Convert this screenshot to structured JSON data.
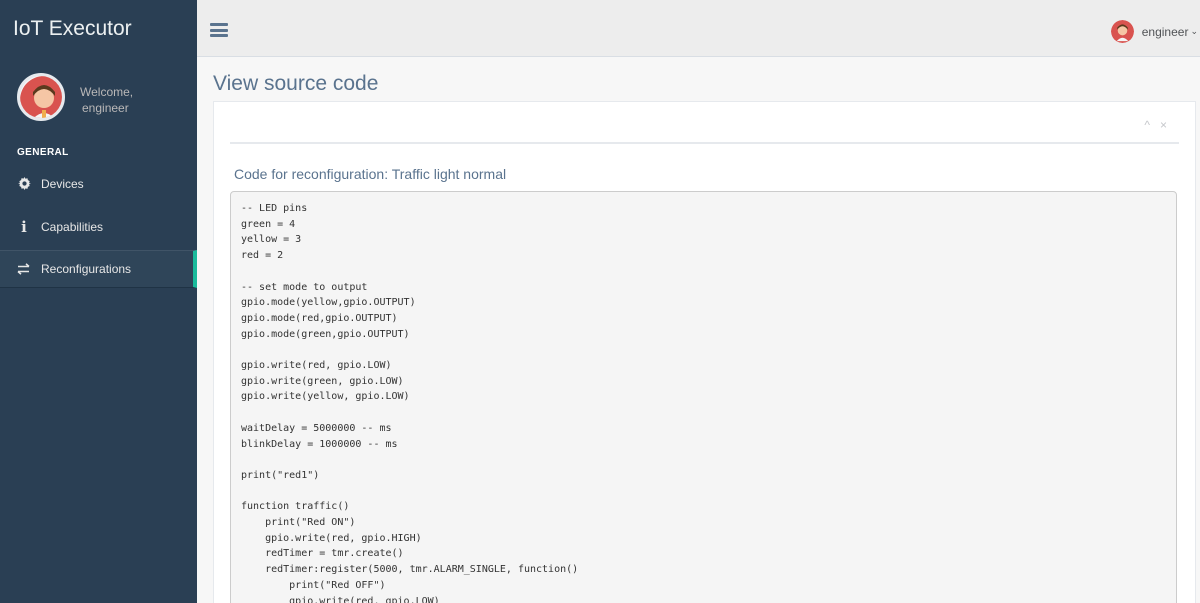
{
  "app": {
    "title": "IoT Executor"
  },
  "profile": {
    "welcome": "Welcome,",
    "name": "engineer"
  },
  "sidebar": {
    "section_title": "GENERAL",
    "items": [
      {
        "label": "Devices",
        "icon": "gear-icon"
      },
      {
        "label": "Capabilities",
        "icon": "info-icon"
      },
      {
        "label": "Reconfigurations",
        "icon": "exchange-arrows-icon",
        "active": true
      }
    ]
  },
  "topbar": {
    "user_name": "engineer"
  },
  "page": {
    "title": "View source code",
    "panel_tools": {
      "collapse": "^",
      "close": "×"
    },
    "subtitle": "Code for reconfiguration: Traffic light normal",
    "code": "-- LED pins\ngreen = 4\nyellow = 3\nred = 2\n\n-- set mode to output\ngpio.mode(yellow,gpio.OUTPUT)\ngpio.mode(red,gpio.OUTPUT)\ngpio.mode(green,gpio.OUTPUT)\n\ngpio.write(red, gpio.LOW)\ngpio.write(green, gpio.LOW)\ngpio.write(yellow, gpio.LOW)\n\nwaitDelay = 5000000 -- ms\nblinkDelay = 1000000 -- ms\n\nprint(\"red1\")\n\nfunction traffic()\n    print(\"Red ON\")\n    gpio.write(red, gpio.HIGH)\n    redTimer = tmr.create()\n    redTimer:register(5000, tmr.ALARM_SINGLE, function()\n        print(\"Red OFF\")\n        gpio.write(red, gpio.LOW)"
  },
  "colors": {
    "sidebar_bg": "#2a3f54",
    "accent": "#1abb9c",
    "title": "#5a738e"
  }
}
